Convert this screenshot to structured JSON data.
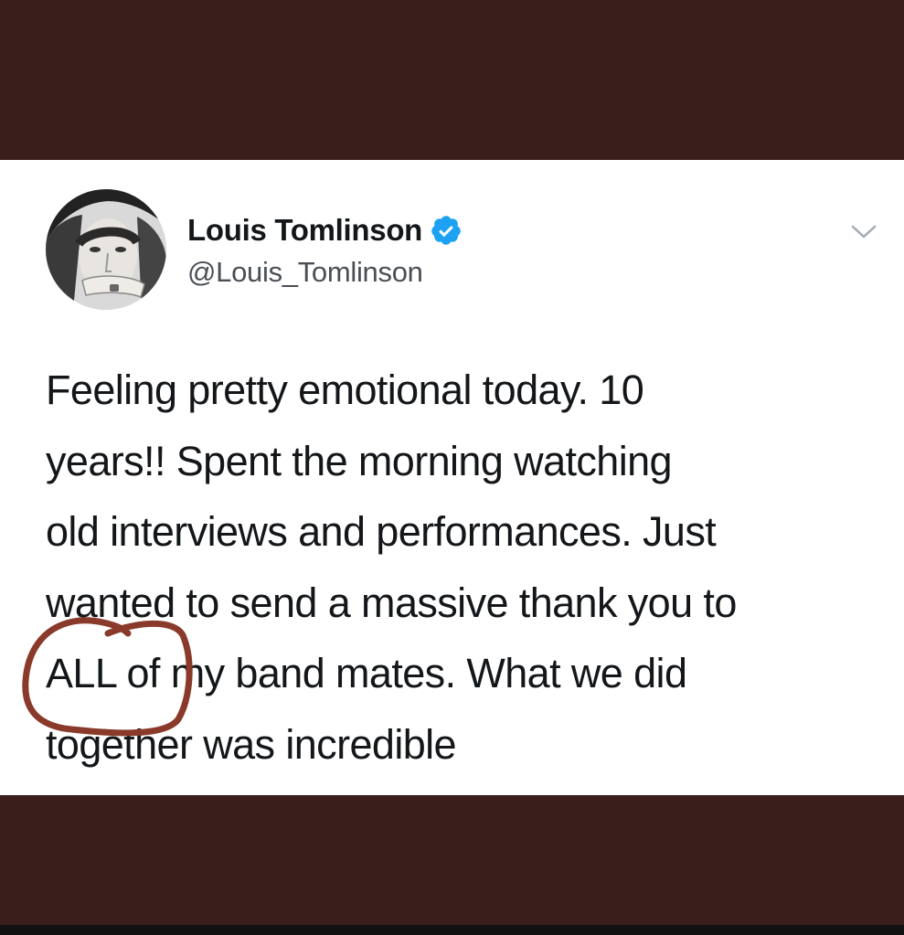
{
  "colors": {
    "background_band": "#3a1e1c",
    "card": "#ffffff",
    "name_text": "#14171a",
    "handle_text": "#4a4f55",
    "verified_badge": "#1da1f2",
    "annotation_circle": "#8a3a2a"
  },
  "tweet": {
    "author": {
      "display_name": "Louis Tomlinson",
      "handle": "@Louis_Tomlinson",
      "verified": true,
      "avatar_icon": "profile-photo"
    },
    "menu_icon": "chevron-down-icon",
    "text_lines": [
      "Feeling pretty emotional today. 10",
      "years!! Spent the morning watching",
      "old interviews and performances. Just",
      "wanted to send a massive thank you to",
      "ALL of my band mates. What we did",
      "together was incredible"
    ]
  },
  "annotation": {
    "type": "hand-drawn-circle",
    "encircled_text": "ALL of"
  }
}
